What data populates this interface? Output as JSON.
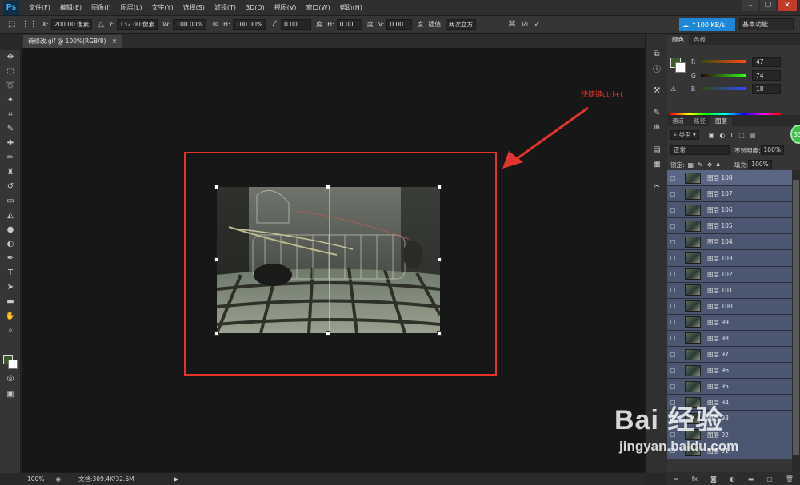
{
  "app": {
    "logo": "Ps"
  },
  "menu": [
    "文件(F)",
    "编辑(E)",
    "图像(I)",
    "图层(L)",
    "文字(Y)",
    "选择(S)",
    "滤镜(T)",
    "3D(D)",
    "视图(V)",
    "窗口(W)",
    "帮助(H)"
  ],
  "options": {
    "x_label": "X:",
    "x_value": "200.00 像素",
    "y_label": "Y:",
    "y_value": "132.00 像素",
    "w_label": "W:",
    "w_value": "100.00%",
    "h_label": "H:",
    "h_value": "100.00%",
    "angle_value": "0.00",
    "angle_unit": "度",
    "hskew_label": "H:",
    "hskew_value": "0.00",
    "hskew_unit": "度",
    "vskew_label": "V:",
    "vskew_value": "0.00",
    "vskew_unit": "度",
    "interp_label": "插值:",
    "interp_value": "两次立方",
    "speed": "↑100 KB/s",
    "workspace": "基本功能"
  },
  "document": {
    "tab_title": "待修改.gif @ 100%(RGB/8)"
  },
  "canvas": {
    "annotation": "快捷键ctrl+t"
  },
  "status": {
    "zoom": "100%",
    "doc_info": "文档:309.4K/32.6M"
  },
  "color_panel": {
    "tabs": [
      "颜色",
      "色板"
    ],
    "r_label": "R",
    "r_value": "47",
    "g_label": "G",
    "g_value": "74",
    "b_label": "B",
    "b_value": "18"
  },
  "layers_panel": {
    "tabs": [
      "通道",
      "路径",
      "图层"
    ],
    "filter": "类型",
    "blend_mode": "正常",
    "opacity_label": "不透明度:",
    "opacity_value": "100%",
    "lock_label": "锁定:",
    "fill_label": "填充:",
    "fill_value": "100%",
    "badge": "33",
    "layers": [
      "图层 108",
      "图层 107",
      "图层 106",
      "图层 105",
      "图层 104",
      "图层 103",
      "图层 102",
      "图层 101",
      "图层 100",
      "图层 99",
      "图层 98",
      "图层 97",
      "图层 96",
      "图层 95",
      "图层 94",
      "图层 93",
      "图层 92",
      "图层 91"
    ]
  },
  "watermark": {
    "main": "Bai 经验",
    "sub": "jingyan.baidu.com"
  },
  "colors": {
    "accent_red": "#e2342c",
    "layer_selected": "#4b5670",
    "ps_blue": "#1f88d6",
    "foreground": "#3c5a2c"
  }
}
